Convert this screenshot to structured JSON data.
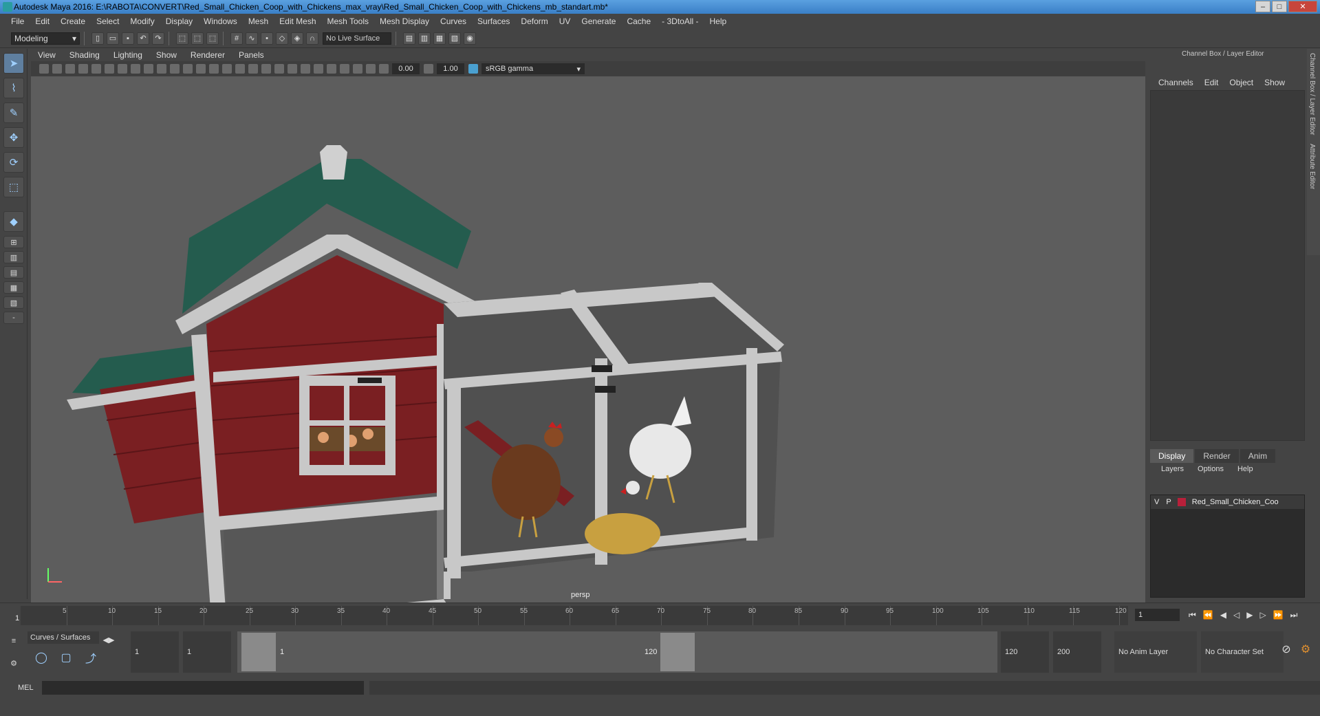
{
  "window": {
    "title": "Autodesk Maya 2016: E:\\RABOTA\\CONVERT\\Red_Small_Chicken_Coop_with_Chickens_max_vray\\Red_Small_Chicken_Coop_with_Chickens_mb_standart.mb*"
  },
  "menubar": {
    "items": [
      "File",
      "Edit",
      "Create",
      "Select",
      "Modify",
      "Display",
      "Windows",
      "Mesh",
      "Edit Mesh",
      "Mesh Tools",
      "Mesh Display",
      "Curves",
      "Surfaces",
      "Deform",
      "UV",
      "Generate",
      "Cache",
      "- 3DtoAll -",
      "Help"
    ]
  },
  "shelf": {
    "mode": "Modeling",
    "live_surface": "No Live Surface"
  },
  "panel": {
    "menu": [
      "View",
      "Shading",
      "Lighting",
      "Show",
      "Renderer",
      "Panels"
    ],
    "exposure": "0.00",
    "gamma": "1.00",
    "color_space": "sRGB gamma",
    "camera_label": "persp"
  },
  "right_panel": {
    "title": "Channel Box / Layer Editor",
    "menu": [
      "Channels",
      "Edit",
      "Object",
      "Show"
    ],
    "tabs": [
      "Display",
      "Render",
      "Anim"
    ],
    "layer_menu": [
      "Layers",
      "Options",
      "Help"
    ],
    "layer": {
      "v": "V",
      "p": "P",
      "name": "Red_Small_Chicken_Coo",
      "color": "#b8203a"
    },
    "side_tabs": [
      "Channel Box / Layer Editor",
      "Attribute Editor"
    ]
  },
  "timeline": {
    "ticks": [
      "5",
      "10",
      "15",
      "20",
      "25",
      "30",
      "35",
      "40",
      "45",
      "50",
      "55",
      "60",
      "65",
      "70",
      "75",
      "80",
      "85",
      "90",
      "95",
      "100",
      "105",
      "110",
      "115",
      "120"
    ],
    "current": "1",
    "frame_field": "1"
  },
  "range": {
    "shelf_tab": "Curves / Surfaces",
    "start": "1",
    "inner_start": "1",
    "slider_start": "1",
    "slider_end": "120",
    "end": "120",
    "max_end": "200",
    "anim_layer": "No Anim Layer",
    "char_set": "No Character Set"
  },
  "cmdline": {
    "label": "MEL"
  }
}
